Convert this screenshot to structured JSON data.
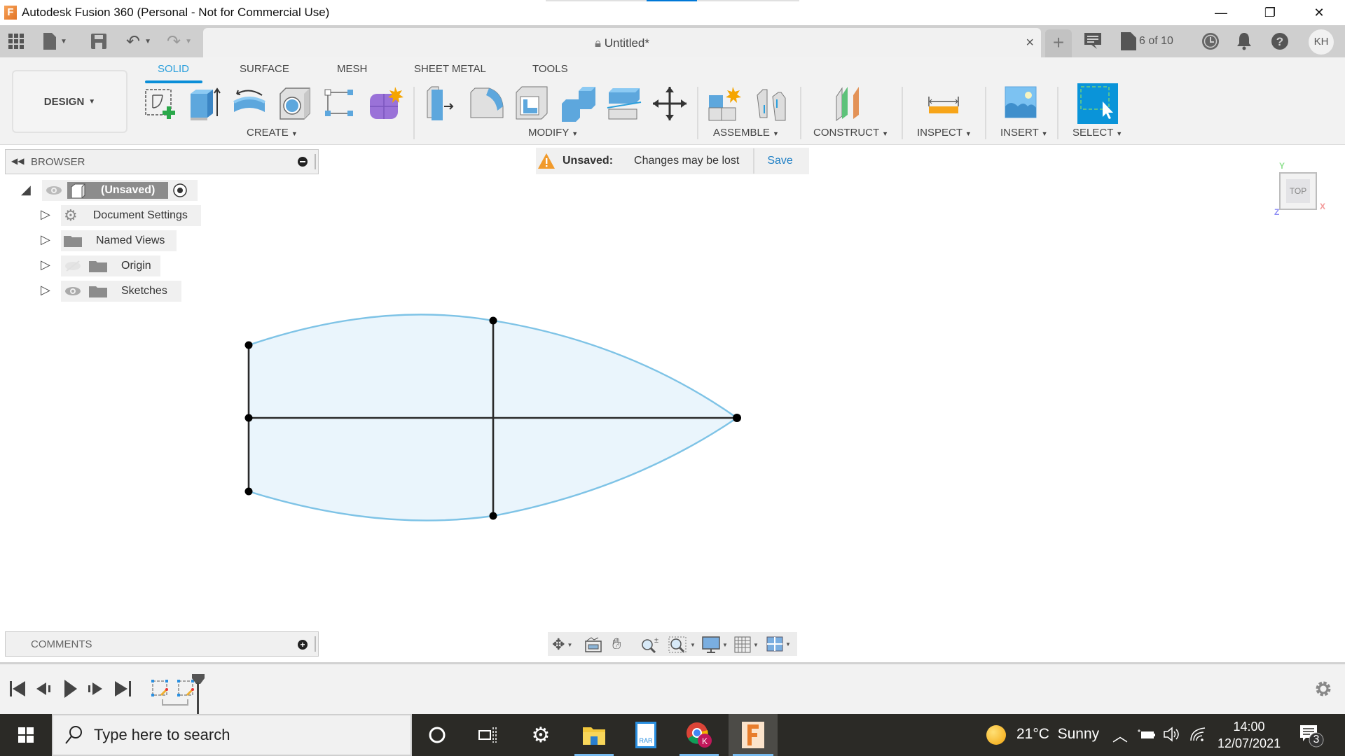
{
  "window": {
    "title": "Autodesk Fusion 360 (Personal - Not for Commercial Use)",
    "app_icon_letter": "F",
    "controls": {
      "minimize": "—",
      "restore": "❐",
      "close": "✕"
    }
  },
  "quick_access": {
    "icons": [
      "data-panel-grid-icon",
      "file-icon",
      "save-icon",
      "undo-icon",
      "redo-icon"
    ],
    "document_tab": {
      "title": "Untitled*",
      "lock_icon": "lock-icon",
      "close": "×"
    },
    "new_tab": "+",
    "right": {
      "job_status": "6 of 10",
      "icons": [
        "comments-icon",
        "job-status-icon",
        "history-clock-icon",
        "notification-bell-icon",
        "help-icon"
      ],
      "avatar_initials": "KH"
    }
  },
  "ribbon": {
    "workspace": "DESIGN",
    "tabs": [
      {
        "label": "SOLID",
        "active": true
      },
      {
        "label": "SURFACE",
        "active": false
      },
      {
        "label": "MESH",
        "active": false
      },
      {
        "label": "SHEET METAL",
        "active": false
      },
      {
        "label": "TOOLS",
        "active": false
      }
    ],
    "groups": [
      {
        "label": "CREATE",
        "tools": [
          "create-sketch",
          "extrude",
          "revolve",
          "hole",
          "pattern",
          "create-form"
        ]
      },
      {
        "label": "MODIFY",
        "tools": [
          "press-pull",
          "fillet",
          "shell",
          "combine",
          "split-body",
          "move-copy"
        ]
      },
      {
        "label": "ASSEMBLE",
        "tools": [
          "new-component",
          "joint"
        ]
      },
      {
        "label": "CONSTRUCT",
        "tools": [
          "offset-plane"
        ]
      },
      {
        "label": "INSPECT",
        "tools": [
          "measure"
        ]
      },
      {
        "label": "INSERT",
        "tools": [
          "insert-image"
        ]
      },
      {
        "label": "SELECT",
        "tools": [
          "window-select"
        ]
      }
    ]
  },
  "browser": {
    "title": "BROWSER",
    "root": {
      "label": "(Unsaved)"
    },
    "items": [
      {
        "label": "Document Settings",
        "icon": "gear-icon",
        "visibility": "none"
      },
      {
        "label": "Named Views",
        "icon": "folder-icon",
        "visibility": "none"
      },
      {
        "label": "Origin",
        "icon": "folder-icon",
        "visibility": "hidden"
      },
      {
        "label": "Sketches",
        "icon": "folder-icon",
        "visibility": "visible"
      }
    ]
  },
  "unsaved_banner": {
    "label": "Unsaved:",
    "message": "Changes may be lost",
    "action": "Save"
  },
  "viewcube": {
    "face": "TOP",
    "axes": {
      "x": "X",
      "y": "Y",
      "z": "Z"
    }
  },
  "comments": {
    "title": "COMMENTS"
  },
  "navbar": {
    "icons": [
      "orbit-icon",
      "look-at-icon",
      "pan-hand-icon",
      "zoom-icon",
      "fit-window-icon",
      "display-settings-icon",
      "grid-settings-icon",
      "viewports-icon"
    ]
  },
  "timeline": {
    "controls": [
      "skip-start-icon",
      "step-back-icon",
      "play-icon",
      "step-forward-icon",
      "skip-end-icon"
    ],
    "features": [
      "sketch-feature",
      "sketch-feature"
    ]
  },
  "taskbar": {
    "search_placeholder": "Type here to search",
    "apps": [
      "cortana",
      "task-view",
      "settings",
      "file-explorer",
      "winrar",
      "chrome",
      "fusion-360"
    ],
    "weather": {
      "temp": "21°C",
      "condition": "Sunny"
    },
    "time": "14:00",
    "date": "12/07/2021",
    "notifications_count": "3"
  },
  "colors": {
    "accent": "#0a8ed8",
    "sketch_profile_fill": "#eaf5fc",
    "sketch_curve": "#7ec3e6",
    "sketch_line": "#2a2a2a",
    "warning": "#f19a2b"
  }
}
